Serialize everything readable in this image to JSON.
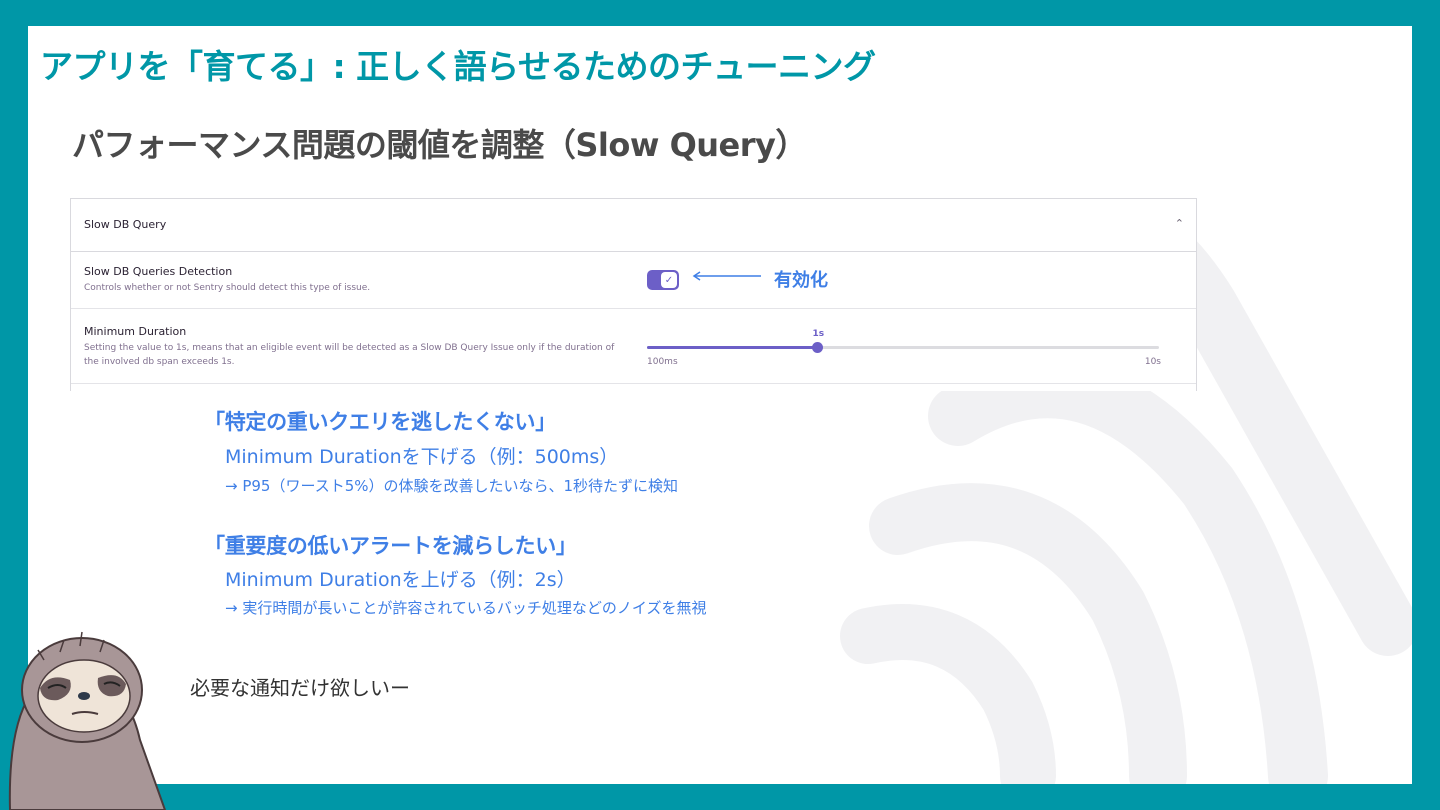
{
  "slide": {
    "title": "アプリを「育てる」: 正しく語らせるためのチューニング",
    "section_title": "パフォーマンス問題の閾値を調整（Slow Query）"
  },
  "panel": {
    "header_title": "Slow DB Query",
    "detection": {
      "label": "Slow DB Queries Detection",
      "help": "Controls whether or not Sentry should detect this type of issue.",
      "enabled": true
    },
    "duration": {
      "label": "Minimum Duration",
      "help": "Setting the value to 1s, means that an eligible event will be detected as a Slow DB Query Issue only if the duration of the involved db span exceeds 1s.",
      "value_label": "1s",
      "min_label": "100ms",
      "max_label": "10s",
      "position_fraction": 0.333
    }
  },
  "callout": {
    "label": "有効化"
  },
  "tips": [
    {
      "heading": "「特定の重いクエリを逃したくない」",
      "setting": "Minimum Durationを下げる（例：500ms）",
      "note": "→ P95（ワースト5%）の体験を改善したいなら、1秒待たずに検知"
    },
    {
      "heading": "「重要度の低いアラートを減らしたい」",
      "setting": "Minimum Durationを上げる（例：2s）",
      "note": "→ 実行時間が長いことが許容されているバッチ処理などのノイズを無視"
    }
  ],
  "speech": "必要な通知だけ欲しいー",
  "colors": {
    "teal": "#0097a7",
    "accent_blue": "#3f7fe6",
    "sentry_purple": "#6c5fc7"
  }
}
